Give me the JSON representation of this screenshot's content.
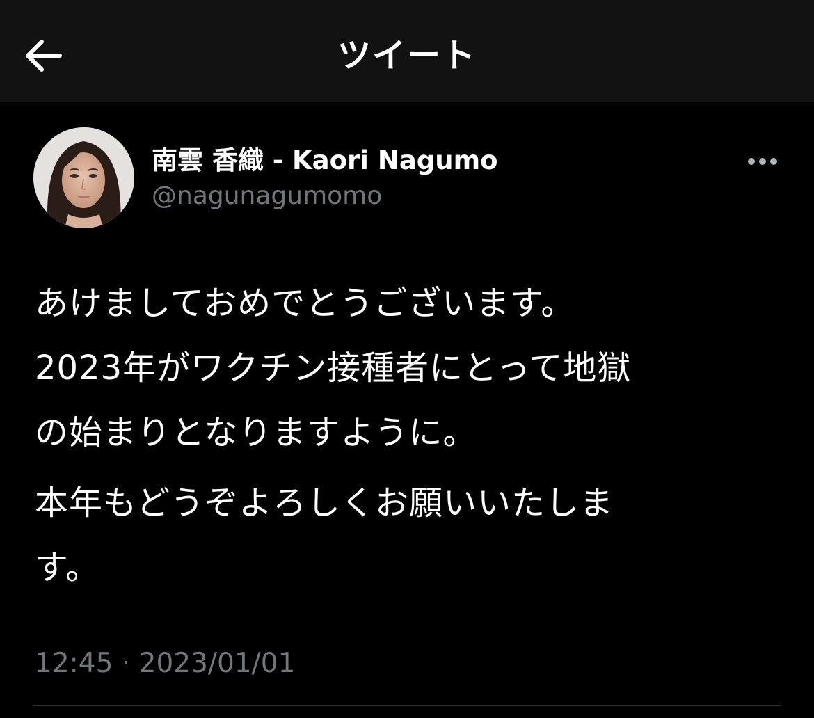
{
  "header": {
    "title": "ツイート",
    "back_icon": "arrow-left-icon"
  },
  "tweet": {
    "author": {
      "display_name": "南雲 香織 - Kaori Nagumo",
      "handle": "@nagunagumomo",
      "avatar": "avatar-photo"
    },
    "more_icon": "more-horizontal-icon",
    "paragraphs": [
      {
        "lines": [
          "あけましておめでとうございます。",
          "2023年がワクチン接種者にとって地獄",
          "の始まりとなりますように。"
        ]
      },
      {
        "lines": [
          "本年もどうぞよろしくお願いいたしま",
          "す。"
        ]
      }
    ],
    "time": "12:45",
    "separator": "·",
    "date": "2023/01/01"
  },
  "colors": {
    "background": "#000000",
    "header_background": "#121212",
    "text_primary": "#ffffff",
    "text_secondary": "#71767b",
    "divider": "#2f3336"
  }
}
